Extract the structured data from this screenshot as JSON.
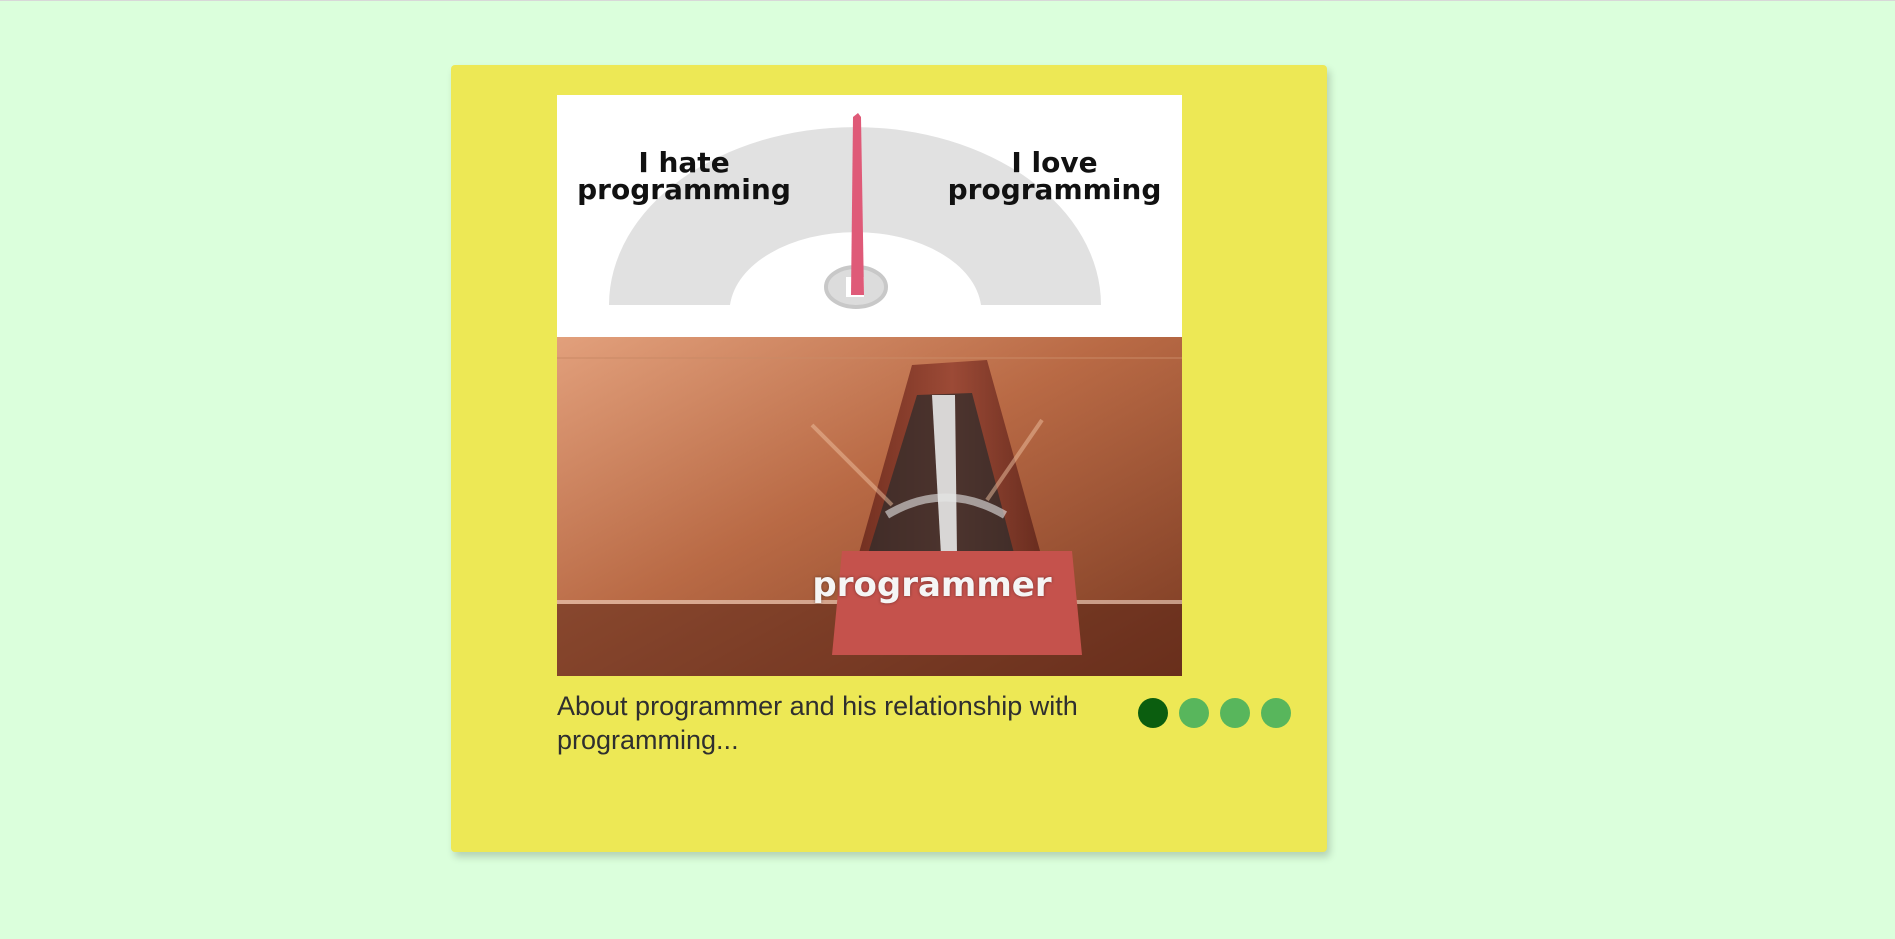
{
  "meme": {
    "gauge_left_label_line1": "I hate",
    "gauge_left_label_line2": "programming",
    "gauge_right_label_line1": "I love",
    "gauge_right_label_line2": "programming",
    "bottom_label": "programmer"
  },
  "caption": "About programmer and his relationship with programming...",
  "carousel": {
    "dots": [
      {
        "active": true
      },
      {
        "active": false
      },
      {
        "active": false
      },
      {
        "active": false
      }
    ]
  },
  "colors": {
    "background": "#dbffdc",
    "card": "#ede855",
    "dot_active": "#0b5e0f",
    "dot_inactive": "#58b65c"
  }
}
